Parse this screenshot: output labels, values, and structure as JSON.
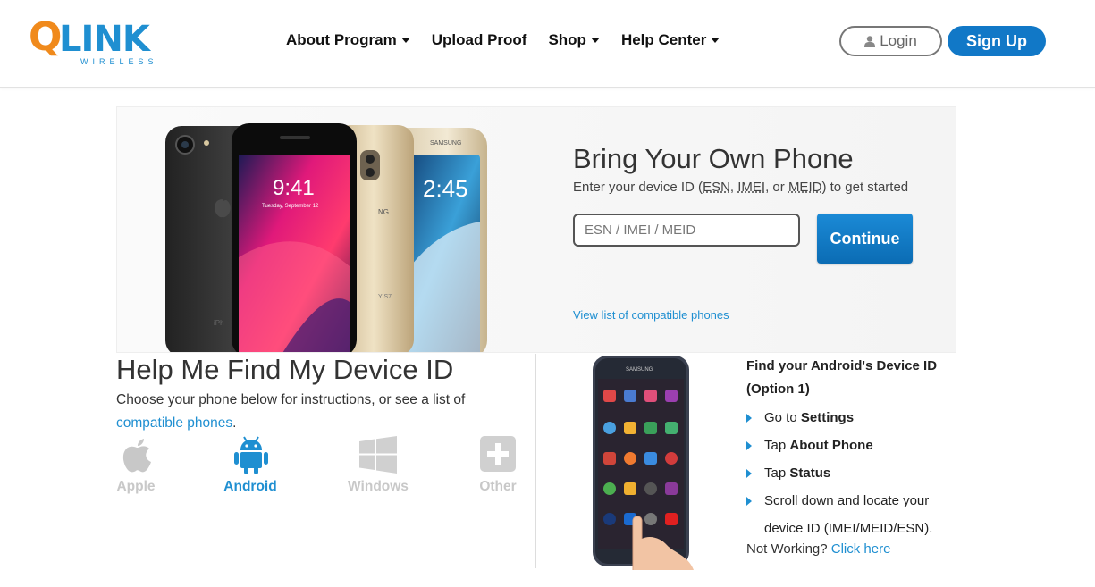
{
  "header": {
    "logo": {
      "q": "Q",
      "link": "LINK",
      "wireless": "WIRELESS"
    },
    "nav": [
      {
        "label": "About Program",
        "dropdown": true
      },
      {
        "label": "Upload Proof",
        "dropdown": false
      },
      {
        "label": "Shop",
        "dropdown": true
      },
      {
        "label": "Help Center",
        "dropdown": true
      }
    ],
    "login_label": "Login",
    "signup_label": "Sign Up"
  },
  "hero": {
    "title": "Bring Your Own Phone",
    "subtitle_prefix": "Enter your device ID (",
    "subtitle_esn": "ESN",
    "subtitle_imei": "IMEI",
    "subtitle_or": ", or ",
    "subtitle_meid": "MEID",
    "subtitle_suffix": ") to get started",
    "input_placeholder": "ESN / IMEI / MEID",
    "input_value": "",
    "continue_label": "Continue",
    "compatible_link": "View list of compatible phones",
    "phone_times": [
      "9:41",
      "2:45"
    ],
    "phone_date": "Tuesday, September 12"
  },
  "help": {
    "title": "Help Me Find My Device ID",
    "sub_text": "Choose your phone below for instructions, or see a list of ",
    "sub_link": "compatible phones",
    "sub_end": ".",
    "os_options": [
      {
        "label": "Apple",
        "selected": false,
        "icon": "apple-icon"
      },
      {
        "label": "Android",
        "selected": true,
        "icon": "android-icon"
      },
      {
        "label": "Windows",
        "selected": false,
        "icon": "windows-icon"
      },
      {
        "label": "Other",
        "selected": false,
        "icon": "plus-icon"
      }
    ]
  },
  "instructions": {
    "title": "Find your Android's Device ID (Option 1)",
    "steps": [
      {
        "text": "Go to ",
        "bold": "Settings"
      },
      {
        "text": "Tap ",
        "bold": "About Phone"
      },
      {
        "text": "Tap ",
        "bold": "Status"
      },
      {
        "text": "Scroll down and locate your device ID (IMEI/MEID/ESN).",
        "bold": ""
      }
    ],
    "not_working": "Not Working? ",
    "click_here": "Click here",
    "phone_brand": "SAMSUNG"
  },
  "colors": {
    "brand_blue": "#1f8fd1",
    "brand_orange": "#f08a1c",
    "button_blue": "#1178c7",
    "inactive_gray": "#c8c8c8"
  }
}
